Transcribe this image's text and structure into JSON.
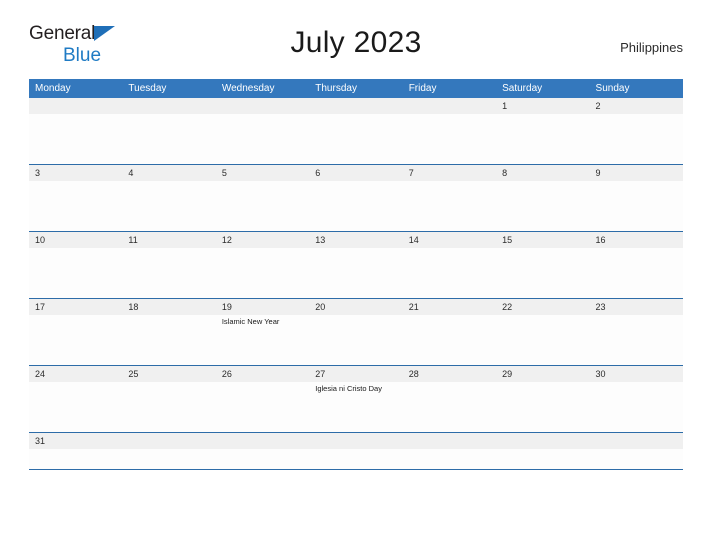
{
  "brand": {
    "line1": "General",
    "line2": "Blue",
    "accent_color": "#1f7bc4",
    "flag_color": "#1f6fb8"
  },
  "header": {
    "title": "July 2023",
    "region": "Philippines"
  },
  "calendar": {
    "header_bg": "#3478bd",
    "row_border_color": "#2d6ca8",
    "date_strip_bg": "#f0f0f0",
    "weekdays": [
      "Monday",
      "Tuesday",
      "Wednesday",
      "Thursday",
      "Friday",
      "Saturday",
      "Sunday"
    ],
    "weeks": [
      [
        {
          "date": "",
          "events": []
        },
        {
          "date": "",
          "events": []
        },
        {
          "date": "",
          "events": []
        },
        {
          "date": "",
          "events": []
        },
        {
          "date": "",
          "events": []
        },
        {
          "date": "1",
          "events": []
        },
        {
          "date": "2",
          "events": []
        }
      ],
      [
        {
          "date": "3",
          "events": []
        },
        {
          "date": "4",
          "events": []
        },
        {
          "date": "5",
          "events": []
        },
        {
          "date": "6",
          "events": []
        },
        {
          "date": "7",
          "events": []
        },
        {
          "date": "8",
          "events": []
        },
        {
          "date": "9",
          "events": []
        }
      ],
      [
        {
          "date": "10",
          "events": []
        },
        {
          "date": "11",
          "events": []
        },
        {
          "date": "12",
          "events": []
        },
        {
          "date": "13",
          "events": []
        },
        {
          "date": "14",
          "events": []
        },
        {
          "date": "15",
          "events": []
        },
        {
          "date": "16",
          "events": []
        }
      ],
      [
        {
          "date": "17",
          "events": []
        },
        {
          "date": "18",
          "events": []
        },
        {
          "date": "19",
          "events": [
            "Islamic New Year"
          ]
        },
        {
          "date": "20",
          "events": []
        },
        {
          "date": "21",
          "events": []
        },
        {
          "date": "22",
          "events": []
        },
        {
          "date": "23",
          "events": []
        }
      ],
      [
        {
          "date": "24",
          "events": []
        },
        {
          "date": "25",
          "events": []
        },
        {
          "date": "26",
          "events": []
        },
        {
          "date": "27",
          "events": [
            "Iglesia ni Cristo Day"
          ]
        },
        {
          "date": "28",
          "events": []
        },
        {
          "date": "29",
          "events": []
        },
        {
          "date": "30",
          "events": []
        }
      ],
      [
        {
          "date": "31",
          "events": []
        },
        {
          "date": "",
          "events": []
        },
        {
          "date": "",
          "events": []
        },
        {
          "date": "",
          "events": []
        },
        {
          "date": "",
          "events": []
        },
        {
          "date": "",
          "events": []
        },
        {
          "date": "",
          "events": []
        }
      ]
    ]
  }
}
